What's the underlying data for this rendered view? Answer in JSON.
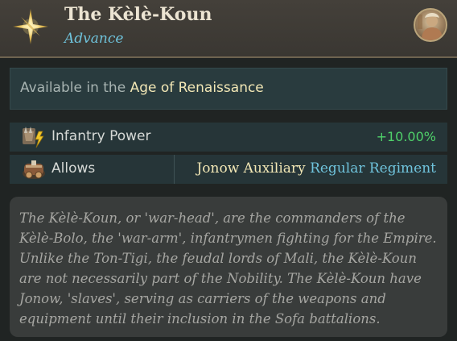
{
  "header": {
    "title": "The Kèlè-Koun",
    "subtitle": "Advance",
    "icon": "compass-star-icon",
    "avatar": "portrait-avatar"
  },
  "availability": {
    "prefix": "Available in the ",
    "age": "Age of Renaissance"
  },
  "stats": [
    {
      "icon": "infantry-power-icon",
      "label": "Infantry Power",
      "value": "+10.00%",
      "value_color": "#4fd16a"
    },
    {
      "icon": "unit-unlock-icon",
      "label": "Allows",
      "link_primary": "Jonow Auxiliary",
      "link_secondary": "Regular Regiment"
    }
  ],
  "description": "The Kèlè-Koun, or 'war-head', are the commanders of the Kèlè-Bolo, the 'war-arm', infantrymen fighting for the Empire. Unlike the Ton-Tigi, the feudal lords of Mali, the Kèlè-Koun are not necessarily part of the Nobility. The Kèlè-Koun have Jonow, 'slaves', serving as carriers of the weapons and equipment until their inclusion in the Sofa battalions.",
  "colors": {
    "accent_blue": "#6fc3dc",
    "accent_gold": "#f2e7b5",
    "positive_green": "#4fd16a"
  }
}
